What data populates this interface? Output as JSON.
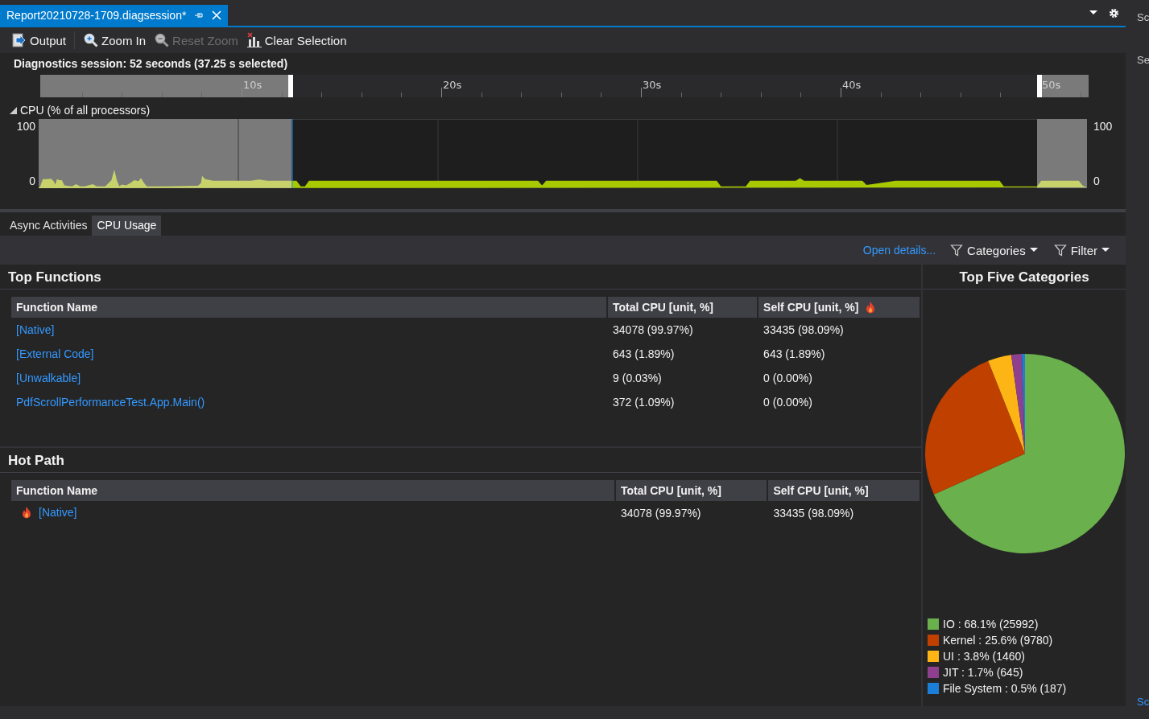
{
  "document_tab": {
    "title": "Report20210728-1709.diagsession*",
    "selected": true
  },
  "toolbar": [
    {
      "label": "Output",
      "kind": "output",
      "disabled": false
    },
    {
      "label": "Zoom In",
      "kind": "zoom-in",
      "disabled": false
    },
    {
      "label": "Reset Zoom",
      "kind": "reset-zoom",
      "disabled": true
    },
    {
      "label": "Clear Selection",
      "kind": "clear-selection",
      "disabled": false
    }
  ],
  "session_label": "Diagnostics session: 52 seconds (37.25 s selected)",
  "ruler": {
    "ticks": [
      "10s",
      "20s",
      "30s",
      "40s",
      "50s"
    ]
  },
  "cpu": {
    "title": "CPU (% of all processors)",
    "expanded": true,
    "left_axis": [
      "100",
      "0"
    ],
    "right_axis": [
      "100",
      "0"
    ]
  },
  "detail_tabs": [
    {
      "label": "Async Activities",
      "selected": false
    },
    {
      "label": "CPU Usage",
      "selected": true
    }
  ],
  "actions": {
    "link": "Open details...",
    "dropdowns": [
      "Categories",
      "Filter"
    ]
  },
  "top_functions": {
    "title": "Top Functions",
    "columns": [
      {
        "label": "Function Name",
        "hot": false
      },
      {
        "label": "Total CPU [unit, %]",
        "hot": false
      },
      {
        "label": "Self CPU [unit, %]",
        "hot": true
      }
    ],
    "rows": [
      {
        "name": "[Native]",
        "hot": false,
        "total": "34078 (99.97%)",
        "self": "33435 (98.09%)"
      },
      {
        "name": "[External Code]",
        "hot": false,
        "total": "643 (1.89%)",
        "self": "643 (1.89%)"
      },
      {
        "name": "[Unwalkable]",
        "hot": false,
        "total": "9 (0.03%)",
        "self": "0 (0.00%)"
      },
      {
        "name": "PdfScrollPerformanceTest.App.Main()",
        "hot": false,
        "total": "372 (1.09%)",
        "self": "0 (0.00%)"
      }
    ]
  },
  "hot_path": {
    "title": "Hot Path",
    "columns": [
      {
        "label": "Function Name",
        "hot": false
      },
      {
        "label": "Total CPU [unit, %]",
        "hot": false
      },
      {
        "label": "Self CPU [unit, %]",
        "hot": false
      }
    ],
    "rows": [
      {
        "name": "[Native]",
        "hot": true,
        "total": "34078 (99.97%)",
        "self": "33435 (98.09%)"
      }
    ]
  },
  "categories": {
    "title": "Top Five Categories",
    "chart_data": {
      "type": "pie",
      "values": [
        68.1,
        25.6,
        3.8,
        1.7,
        0.5
      ]
    },
    "legend": [
      {
        "label": "IO : 68.1% (25992)",
        "color": "#6ab04c"
      },
      {
        "label": "Kernel : 25.6% (9780)",
        "color": "#c04000"
      },
      {
        "label": "UI : 3.8% (1460)",
        "color": "#fdb515"
      },
      {
        "label": "JIT : 1.7% (645)",
        "color": "#8e3f8e"
      },
      {
        "label": "File System : 0.5% (187)",
        "color": "#1b7fd8"
      }
    ]
  },
  "side_panel": {
    "texts": [
      "Sc",
      "Se"
    ],
    "link": "Sc"
  }
}
